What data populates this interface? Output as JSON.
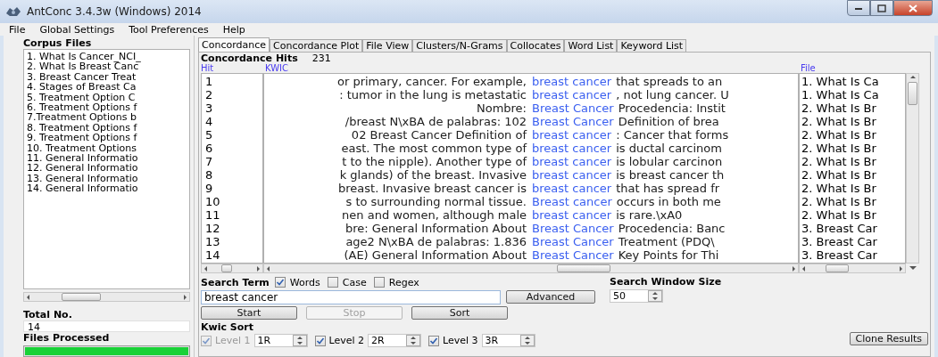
{
  "window": {
    "title": "AntConc 3.4.3w (Windows) 2014"
  },
  "menu": [
    "File",
    "Global Settings",
    "Tool Preferences",
    "Help"
  ],
  "corpus_files": {
    "title": "Corpus Files",
    "items": [
      "1. What Is Cancer_NCI_",
      "2. What Is Breast Canc",
      "3. Breast Cancer Treat",
      "4. Stages of Breast Ca",
      "5. Treatment Option C",
      "6. Treatment Options f",
      "7.Treatment Options b",
      "8. Treatment Options f",
      "9. Treatment Options f",
      "10. Treatment Options",
      "11. General Informatio",
      "12. General Informatio",
      "13. General Informatio",
      "14. General Informatio"
    ]
  },
  "total_no": {
    "label": "Total No.",
    "value": "14"
  },
  "files_processed": {
    "label": "Files Processed",
    "level": 1
  },
  "tabs": [
    {
      "label": "Concordance",
      "selected": true
    },
    {
      "label": "Concordance Plot",
      "selected": false
    },
    {
      "label": "File View",
      "selected": false
    },
    {
      "label": "Clusters/N-Grams",
      "selected": false
    },
    {
      "label": "Collocates",
      "selected": false
    },
    {
      "label": "Word List",
      "selected": false
    },
    {
      "label": "Keyword List",
      "selected": false
    }
  ],
  "concordance": {
    "hits_label": "Concordance Hits",
    "hits_count": "231",
    "columns": [
      "Hit",
      "KWIC",
      "File"
    ],
    "rows": [
      {
        "hit": "1",
        "left": "or primary, cancer. For example,",
        "keyword": "breast cancer",
        "right": "that spreads to an",
        "file": "1. What Is Ca"
      },
      {
        "hit": "2",
        "left": ": tumor in the lung is metastatic",
        "keyword": "breast cancer",
        "right": ", not lung cancer. U",
        "file": "1. What Is Ca"
      },
      {
        "hit": "3",
        "left": "Nombre:",
        "keyword": "Breast Cancer",
        "right": "Procedencia: Instit",
        "file": "2. What Is Br"
      },
      {
        "hit": "4",
        "left": "/breast N\\xBA de palabras: 102",
        "keyword": "Breast Cancer",
        "right": " Definition of brea",
        "file": "2. What Is Br"
      },
      {
        "hit": "5",
        "left": "02  Breast Cancer  Definition of",
        "keyword": "breast cancer",
        "right": ": Cancer that forms",
        "file": "2. What Is Br"
      },
      {
        "hit": "6",
        "left": "east. The most common type of",
        "keyword": "breast cancer",
        "right": "is ductal carcinom",
        "file": "2. What Is Br"
      },
      {
        "hit": "7",
        "left": "t to the nipple). Another type of",
        "keyword": "breast cancer",
        "right": "is lobular carcinon",
        "file": "2. What Is Br"
      },
      {
        "hit": "8",
        "left": "k glands) of the breast. Invasive",
        "keyword": "breast cancer",
        "right": "is breast cancer th",
        "file": "2. What Is Br"
      },
      {
        "hit": "9",
        "left": "breast. Invasive breast cancer is",
        "keyword": "breast cancer",
        "right": "that has spread fr",
        "file": "2. What Is Br"
      },
      {
        "hit": "10",
        "left": "s to surrounding normal tissue.",
        "keyword": "Breast cancer",
        "right": "occurs in both me",
        "file": "2. What Is Br"
      },
      {
        "hit": "11",
        "left": "nen and women, although male",
        "keyword": "breast cancer",
        "right": "is rare.\\xA0",
        "file": "2. What Is Br"
      },
      {
        "hit": "12",
        "left": "bre: General Information About",
        "keyword": "Breast Cancer",
        "right": "Procedencia: Banc",
        "file": "3. Breast Car"
      },
      {
        "hit": "13",
        "left": "age2 N\\xBA de palabras: 1.836",
        "keyword": "Breast Cancer",
        "right": "Treatment (PDQ\\",
        "file": "3. Breast Car"
      },
      {
        "hit": "14",
        "left": "(AE) General Information About",
        "keyword": "Breast Cancer",
        "right": "Key Points for Thi",
        "file": "3. Breast Car"
      }
    ]
  },
  "search": {
    "label": "Search Term",
    "options": [
      {
        "label": "Words",
        "checked": true
      },
      {
        "label": "Case",
        "checked": false
      },
      {
        "label": "Regex",
        "checked": false
      }
    ],
    "value": "breast cancer",
    "advanced": "Advanced"
  },
  "window_size": {
    "label": "Search Window Size",
    "value": "50"
  },
  "buttons": [
    {
      "label": "Start",
      "disabled": false
    },
    {
      "label": "Stop",
      "disabled": true
    },
    {
      "label": "Sort",
      "disabled": false
    }
  ],
  "kwic_sort": {
    "label": "Kwic Sort",
    "levels": [
      {
        "label": "Level 1",
        "value": "1R",
        "checked": true,
        "disabled": true
      },
      {
        "label": "Level 2",
        "value": "2R",
        "checked": true,
        "disabled": false
      },
      {
        "label": "Level 3",
        "value": "3R",
        "checked": true,
        "disabled": false
      }
    ]
  },
  "clone_button": "Clone Results"
}
